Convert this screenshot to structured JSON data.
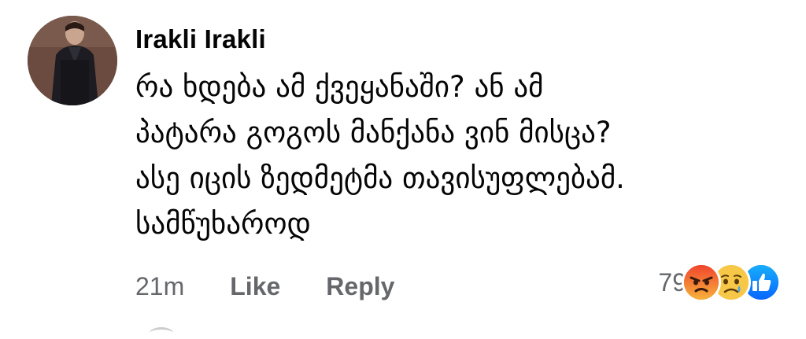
{
  "comment": {
    "author": "Irakli Irakli",
    "text": "რა ხდება ამ ქვეყანაში?  ან ამ\nპატარა გოგოს მანქანა ვინ მისცა?\nასე იცის ზედმეტმა თავისუფლებამ.\nსამწუხაროდ",
    "avatar": {
      "icon": "profile-photo-man-in-dark-jacket"
    }
  },
  "actions": {
    "time": "21m",
    "like_label": "Like",
    "reply_label": "Reply"
  },
  "reactions": {
    "count": "79",
    "icons": [
      "angry-reaction-icon",
      "sad-reaction-icon",
      "like-reaction-icon"
    ],
    "colors": {
      "angry": "#f05a28",
      "sad": "#f7c848",
      "like": "#1877f2"
    }
  }
}
